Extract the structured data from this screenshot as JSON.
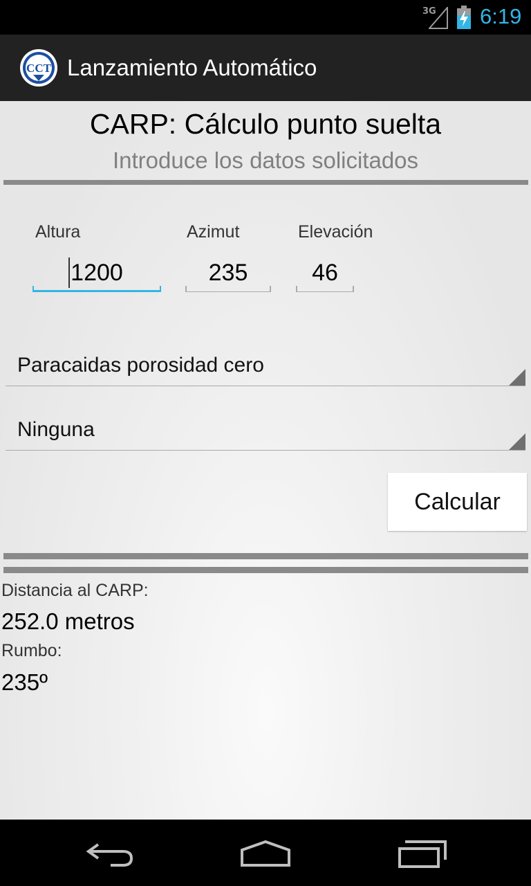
{
  "status_bar": {
    "network": "3G",
    "time": "6:19",
    "time_color": "#33b5e5",
    "icons": [
      "signal-icon",
      "battery-charging-icon"
    ]
  },
  "action_bar": {
    "logo_text": "CCT",
    "title": "Lanzamiento Automático"
  },
  "header": {
    "title": "CARP: Cálculo punto suelta",
    "subtitle": "Introduce los datos solicitados"
  },
  "inputs": {
    "altura": {
      "label": "Altura",
      "value": "1200"
    },
    "azimut": {
      "label": "Azimut",
      "value": "235"
    },
    "elevacion": {
      "label": "Elevación",
      "value": "46"
    }
  },
  "spinners": {
    "parachute": {
      "selected": "Paracaidas porosidad cero"
    },
    "option": {
      "selected": "Ninguna"
    }
  },
  "calculate_button": {
    "label": "Calcular"
  },
  "results": {
    "distance_label": "Distancia al CARP:",
    "distance_value": "252.0 metros",
    "heading_label": "Rumbo:",
    "heading_value": "235º"
  },
  "nav_bar": {
    "icons": [
      "back-icon",
      "home-icon",
      "recent-apps-icon"
    ]
  },
  "colors": {
    "accent": "#33b5e5",
    "action_bar": "#222222",
    "divider": "#8a8a8a"
  }
}
